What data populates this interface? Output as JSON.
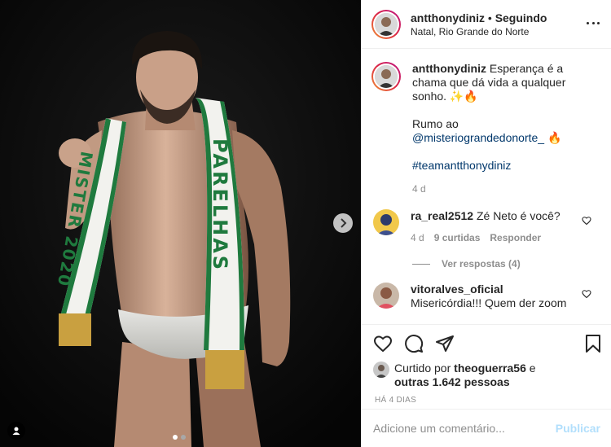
{
  "header": {
    "username": "antthonydiniz",
    "separator": "•",
    "follow_status": "Seguindo",
    "location": "Natal, Rio Grande do Norte"
  },
  "media": {
    "sash_left_text": "MISTER 2020",
    "sash_right_text": "PARELHAS",
    "next_icon": "chevron-right-icon",
    "tag_icon": "user-tag-icon",
    "slide_count": 2,
    "current_slide": 1
  },
  "caption": {
    "username": "antthonydiniz",
    "text1": "Esperança é a chama que dá vida a qualquer sonho. ✨🔥",
    "text2_prefix": "Rumo ao",
    "mention": "@misteriograndedonorte_",
    "text2_suffix": " 🔥",
    "hashtag": "#teamantthonydiniz",
    "time": "4 d"
  },
  "comments": [
    {
      "username": "ra_real2512",
      "text": "Zé Neto é você?",
      "time": "4 d",
      "likes": "9 curtidas",
      "reply": "Responder",
      "replies_label": "Ver respostas (4)"
    },
    {
      "username": "vitoralves_oficial",
      "text": "Misericórdia!!! Quem der zoom"
    }
  ],
  "likes": {
    "prefix": "Curtido por",
    "user": "theoguerra56",
    "conjunction": "e",
    "others": "outras 1.642 pessoas"
  },
  "time_ago": "HÁ 4 DIAS",
  "add_comment": {
    "placeholder": "Adicione um comentário...",
    "publish_label": "Publicar"
  },
  "colors": {
    "link": "#00376b",
    "publish_disabled": "#b2dffc",
    "secondary_text": "#8e8e8e",
    "sash_green": "#1f7a3e",
    "sash_gold": "#c9a040"
  }
}
